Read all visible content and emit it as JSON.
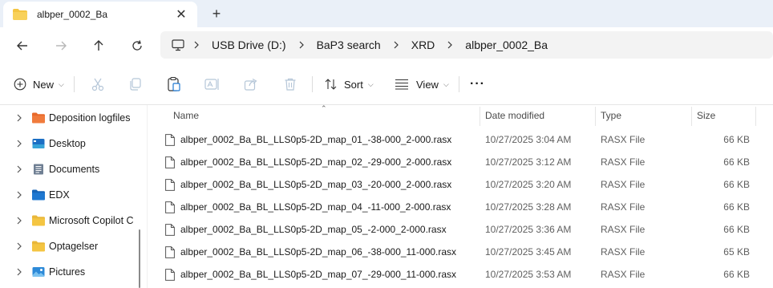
{
  "tab": {
    "title": "albper_0002_Ba",
    "close_glyph": "✕",
    "new_tab_glyph": "+"
  },
  "address": {
    "crumbs": [
      "USB Drive (D:)",
      "BaP3 search",
      "XRD",
      "albper_0002_Ba"
    ]
  },
  "commands": {
    "new_label": "New",
    "sort_label": "Sort",
    "view_label": "View",
    "more_glyph": "···"
  },
  "sidebar": {
    "items": [
      {
        "label": "Deposition logfiles",
        "icon": "folder-orange-icon"
      },
      {
        "label": "Desktop",
        "icon": "desktop-icon"
      },
      {
        "label": "Documents",
        "icon": "documents-icon"
      },
      {
        "label": "EDX",
        "icon": "folder-blue-icon"
      },
      {
        "label": "Microsoft Copilot C",
        "icon": "folder-yellow-icon"
      },
      {
        "label": "Optagelser",
        "icon": "folder-yellow-icon"
      },
      {
        "label": "Pictures",
        "icon": "pictures-icon"
      }
    ]
  },
  "table": {
    "headers": {
      "name": "Name",
      "date": "Date modified",
      "type": "Type",
      "size": "Size"
    },
    "rows": [
      {
        "name": "albper_0002_Ba_BL_LLS0p5-2D_map_01_-38-000_2-000.rasx",
        "date": "10/27/2025 3:04 AM",
        "type": "RASX File",
        "size": "66 KB"
      },
      {
        "name": "albper_0002_Ba_BL_LLS0p5-2D_map_02_-29-000_2-000.rasx",
        "date": "10/27/2025 3:12 AM",
        "type": "RASX File",
        "size": "66 KB"
      },
      {
        "name": "albper_0002_Ba_BL_LLS0p5-2D_map_03_-20-000_2-000.rasx",
        "date": "10/27/2025 3:20 AM",
        "type": "RASX File",
        "size": "66 KB"
      },
      {
        "name": "albper_0002_Ba_BL_LLS0p5-2D_map_04_-11-000_2-000.rasx",
        "date": "10/27/2025 3:28 AM",
        "type": "RASX File",
        "size": "66 KB"
      },
      {
        "name": "albper_0002_Ba_BL_LLS0p5-2D_map_05_-2-000_2-000.rasx",
        "date": "10/27/2025 3:36 AM",
        "type": "RASX File",
        "size": "66 KB"
      },
      {
        "name": "albper_0002_Ba_BL_LLS0p5-2D_map_06_-38-000_11-000.rasx",
        "date": "10/27/2025 3:45 AM",
        "type": "RASX File",
        "size": "65 KB"
      },
      {
        "name": "albper_0002_Ba_BL_LLS0p5-2D_map_07_-29-000_11-000.rasx",
        "date": "10/27/2025 3:53 AM",
        "type": "RASX File",
        "size": "66 KB"
      }
    ]
  },
  "colors": {
    "tabstrip_bg": "#eaf0f8",
    "folder_yellow": "#f4c542",
    "folder_orange": "#e8692a",
    "folder_blue": "#1f78d1"
  }
}
